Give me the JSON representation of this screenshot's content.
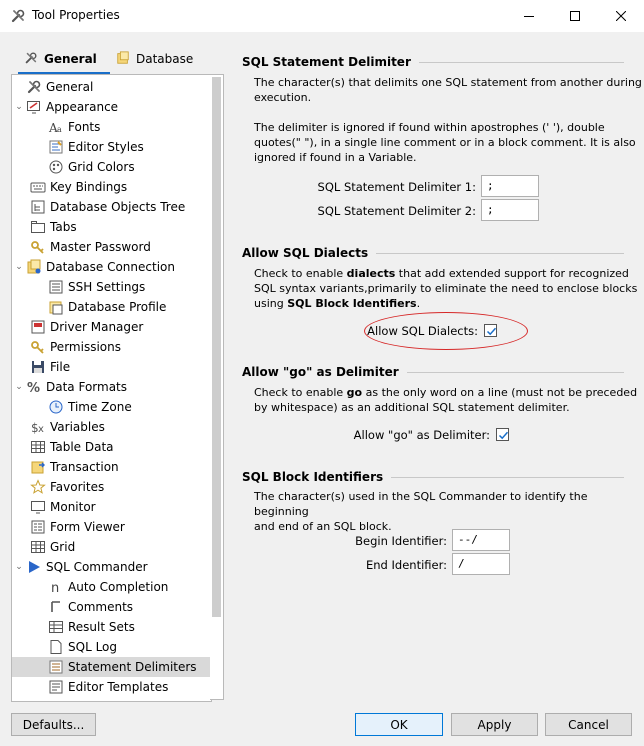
{
  "window": {
    "title": "Tool Properties"
  },
  "tabs": [
    {
      "label": "General"
    },
    {
      "label": "Database"
    }
  ],
  "tree": [
    {
      "label": "General"
    },
    {
      "label": "Appearance"
    },
    {
      "label": "Fonts"
    },
    {
      "label": "Editor Styles"
    },
    {
      "label": "Grid Colors"
    },
    {
      "label": "Key Bindings"
    },
    {
      "label": "Database Objects Tree"
    },
    {
      "label": "Tabs"
    },
    {
      "label": "Master Password"
    },
    {
      "label": "Database Connection"
    },
    {
      "label": "SSH Settings"
    },
    {
      "label": "Database Profile"
    },
    {
      "label": "Driver Manager"
    },
    {
      "label": "Permissions"
    },
    {
      "label": "File"
    },
    {
      "label": "Data Formats"
    },
    {
      "label": "Time Zone"
    },
    {
      "label": "Variables"
    },
    {
      "label": "Table Data"
    },
    {
      "label": "Transaction"
    },
    {
      "label": "Favorites"
    },
    {
      "label": "Monitor"
    },
    {
      "label": "Form Viewer"
    },
    {
      "label": "Grid"
    },
    {
      "label": "SQL Commander"
    },
    {
      "label": "Auto Completion"
    },
    {
      "label": "Comments"
    },
    {
      "label": "Result Sets"
    },
    {
      "label": "SQL Log"
    },
    {
      "label": "Statement Delimiters"
    },
    {
      "label": "Editor Templates"
    }
  ],
  "sections": {
    "delimiter": {
      "title": "SQL Statement Delimiter",
      "desc1a": "The character(s) that delimits one SQL statement from another during",
      "desc1b": "execution.",
      "desc2a": "The delimiter is ignored if found within apostrophes (' '), double",
      "desc2b": "quotes(\" \"), in a single line comment or in a block comment. It is also",
      "desc2c": "ignored if found in a Variable.",
      "label1": "SQL Statement Delimiter 1:",
      "value1": ";",
      "label2": "SQL Statement Delimiter 2:",
      "value2": ";"
    },
    "dialects": {
      "title": "Allow SQL Dialects",
      "l1_pre": "Check to enable ",
      "l1_bold": "dialects",
      "l1_post": " that add extended support for recognized",
      "l2": "SQL syntax variants,primarily to eliminate the need to enclose blocks",
      "l3_pre": "using ",
      "l3_bold": "SQL Block Identifiers",
      "l3_post": ".",
      "checkbox_label": "Allow SQL Dialects:"
    },
    "go": {
      "title": "Allow \"go\" as Delimiter",
      "l1_pre": "Check to enable ",
      "l1_bold": "go",
      "l1_post": " as the only word on a line (must not be preceded",
      "l2": "by whitespace) as an additional SQL statement delimiter.",
      "checkbox_label": "Allow \"go\" as Delimiter:"
    },
    "block": {
      "title": "SQL Block Identifiers",
      "l1": "The character(s) used in the SQL Commander to identify the beginning",
      "l2": "and end of an SQL block.",
      "begin_label": "Begin Identifier:",
      "begin_value": "--/",
      "end_label": "End Identifier:",
      "end_value": "/"
    }
  },
  "buttons": {
    "defaults": "Defaults...",
    "ok": "OK",
    "apply": "Apply",
    "cancel": "Cancel"
  }
}
